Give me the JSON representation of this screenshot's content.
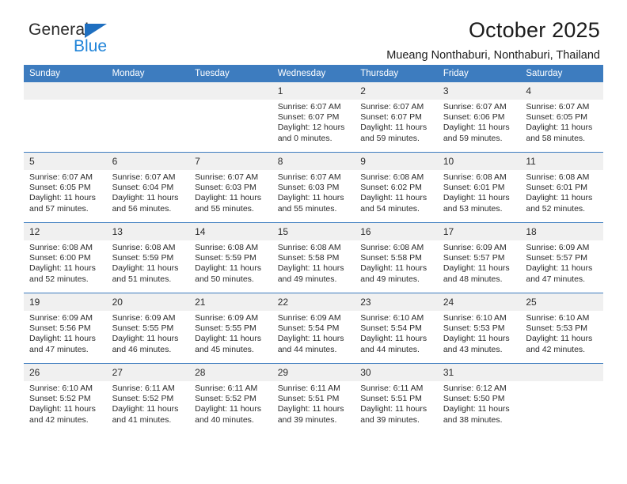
{
  "brand": {
    "name_part1": "General",
    "name_part2": "Blue",
    "flag_icon": "blue-triangle-flag",
    "accent_color": "#1f6fc0",
    "blue_text_color": "#1f83d8"
  },
  "header": {
    "title": "October 2025",
    "subtitle": "Mueang Nonthaburi, Nonthaburi, Thailand"
  },
  "calendar": {
    "header_bg": "#3d7cbf",
    "daynum_bg": "#f0f0f0",
    "weekday_headers": [
      "Sunday",
      "Monday",
      "Tuesday",
      "Wednesday",
      "Thursday",
      "Friday",
      "Saturday"
    ],
    "weeks": [
      [
        {
          "day": "",
          "empty": true
        },
        {
          "day": "",
          "empty": true
        },
        {
          "day": "",
          "empty": true
        },
        {
          "day": "1",
          "sunrise": "Sunrise: 6:07 AM",
          "sunset": "Sunset: 6:07 PM",
          "daylight": "Daylight: 12 hours and 0 minutes."
        },
        {
          "day": "2",
          "sunrise": "Sunrise: 6:07 AM",
          "sunset": "Sunset: 6:07 PM",
          "daylight": "Daylight: 11 hours and 59 minutes."
        },
        {
          "day": "3",
          "sunrise": "Sunrise: 6:07 AM",
          "sunset": "Sunset: 6:06 PM",
          "daylight": "Daylight: 11 hours and 59 minutes."
        },
        {
          "day": "4",
          "sunrise": "Sunrise: 6:07 AM",
          "sunset": "Sunset: 6:05 PM",
          "daylight": "Daylight: 11 hours and 58 minutes."
        }
      ],
      [
        {
          "day": "5",
          "sunrise": "Sunrise: 6:07 AM",
          "sunset": "Sunset: 6:05 PM",
          "daylight": "Daylight: 11 hours and 57 minutes."
        },
        {
          "day": "6",
          "sunrise": "Sunrise: 6:07 AM",
          "sunset": "Sunset: 6:04 PM",
          "daylight": "Daylight: 11 hours and 56 minutes."
        },
        {
          "day": "7",
          "sunrise": "Sunrise: 6:07 AM",
          "sunset": "Sunset: 6:03 PM",
          "daylight": "Daylight: 11 hours and 55 minutes."
        },
        {
          "day": "8",
          "sunrise": "Sunrise: 6:07 AM",
          "sunset": "Sunset: 6:03 PM",
          "daylight": "Daylight: 11 hours and 55 minutes."
        },
        {
          "day": "9",
          "sunrise": "Sunrise: 6:08 AM",
          "sunset": "Sunset: 6:02 PM",
          "daylight": "Daylight: 11 hours and 54 minutes."
        },
        {
          "day": "10",
          "sunrise": "Sunrise: 6:08 AM",
          "sunset": "Sunset: 6:01 PM",
          "daylight": "Daylight: 11 hours and 53 minutes."
        },
        {
          "day": "11",
          "sunrise": "Sunrise: 6:08 AM",
          "sunset": "Sunset: 6:01 PM",
          "daylight": "Daylight: 11 hours and 52 minutes."
        }
      ],
      [
        {
          "day": "12",
          "sunrise": "Sunrise: 6:08 AM",
          "sunset": "Sunset: 6:00 PM",
          "daylight": "Daylight: 11 hours and 52 minutes."
        },
        {
          "day": "13",
          "sunrise": "Sunrise: 6:08 AM",
          "sunset": "Sunset: 5:59 PM",
          "daylight": "Daylight: 11 hours and 51 minutes."
        },
        {
          "day": "14",
          "sunrise": "Sunrise: 6:08 AM",
          "sunset": "Sunset: 5:59 PM",
          "daylight": "Daylight: 11 hours and 50 minutes."
        },
        {
          "day": "15",
          "sunrise": "Sunrise: 6:08 AM",
          "sunset": "Sunset: 5:58 PM",
          "daylight": "Daylight: 11 hours and 49 minutes."
        },
        {
          "day": "16",
          "sunrise": "Sunrise: 6:08 AM",
          "sunset": "Sunset: 5:58 PM",
          "daylight": "Daylight: 11 hours and 49 minutes."
        },
        {
          "day": "17",
          "sunrise": "Sunrise: 6:09 AM",
          "sunset": "Sunset: 5:57 PM",
          "daylight": "Daylight: 11 hours and 48 minutes."
        },
        {
          "day": "18",
          "sunrise": "Sunrise: 6:09 AM",
          "sunset": "Sunset: 5:57 PM",
          "daylight": "Daylight: 11 hours and 47 minutes."
        }
      ],
      [
        {
          "day": "19",
          "sunrise": "Sunrise: 6:09 AM",
          "sunset": "Sunset: 5:56 PM",
          "daylight": "Daylight: 11 hours and 47 minutes."
        },
        {
          "day": "20",
          "sunrise": "Sunrise: 6:09 AM",
          "sunset": "Sunset: 5:55 PM",
          "daylight": "Daylight: 11 hours and 46 minutes."
        },
        {
          "day": "21",
          "sunrise": "Sunrise: 6:09 AM",
          "sunset": "Sunset: 5:55 PM",
          "daylight": "Daylight: 11 hours and 45 minutes."
        },
        {
          "day": "22",
          "sunrise": "Sunrise: 6:09 AM",
          "sunset": "Sunset: 5:54 PM",
          "daylight": "Daylight: 11 hours and 44 minutes."
        },
        {
          "day": "23",
          "sunrise": "Sunrise: 6:10 AM",
          "sunset": "Sunset: 5:54 PM",
          "daylight": "Daylight: 11 hours and 44 minutes."
        },
        {
          "day": "24",
          "sunrise": "Sunrise: 6:10 AM",
          "sunset": "Sunset: 5:53 PM",
          "daylight": "Daylight: 11 hours and 43 minutes."
        },
        {
          "day": "25",
          "sunrise": "Sunrise: 6:10 AM",
          "sunset": "Sunset: 5:53 PM",
          "daylight": "Daylight: 11 hours and 42 minutes."
        }
      ],
      [
        {
          "day": "26",
          "sunrise": "Sunrise: 6:10 AM",
          "sunset": "Sunset: 5:52 PM",
          "daylight": "Daylight: 11 hours and 42 minutes."
        },
        {
          "day": "27",
          "sunrise": "Sunrise: 6:11 AM",
          "sunset": "Sunset: 5:52 PM",
          "daylight": "Daylight: 11 hours and 41 minutes."
        },
        {
          "day": "28",
          "sunrise": "Sunrise: 6:11 AM",
          "sunset": "Sunset: 5:52 PM",
          "daylight": "Daylight: 11 hours and 40 minutes."
        },
        {
          "day": "29",
          "sunrise": "Sunrise: 6:11 AM",
          "sunset": "Sunset: 5:51 PM",
          "daylight": "Daylight: 11 hours and 39 minutes."
        },
        {
          "day": "30",
          "sunrise": "Sunrise: 6:11 AM",
          "sunset": "Sunset: 5:51 PM",
          "daylight": "Daylight: 11 hours and 39 minutes."
        },
        {
          "day": "31",
          "sunrise": "Sunrise: 6:12 AM",
          "sunset": "Sunset: 5:50 PM",
          "daylight": "Daylight: 11 hours and 38 minutes."
        },
        {
          "day": "",
          "empty": true
        }
      ]
    ]
  }
}
